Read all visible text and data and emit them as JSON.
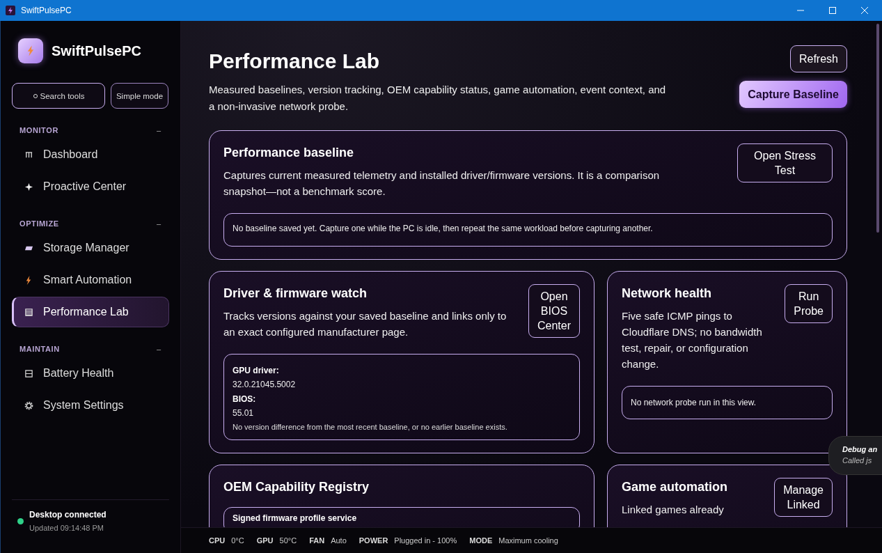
{
  "window": {
    "title": "SwiftPulsePC"
  },
  "sidebar": {
    "brand": "SwiftPulsePC",
    "search_button": "Search tools",
    "mode_button": "Simple mode",
    "sections": [
      {
        "label": "MONITOR",
        "collapse": "–",
        "items": [
          {
            "label": "Dashboard",
            "selected": false
          },
          {
            "label": "Proactive Center",
            "selected": false
          }
        ]
      },
      {
        "label": "OPTIMIZE",
        "collapse": "–",
        "items": [
          {
            "label": "Storage Manager",
            "selected": false
          },
          {
            "label": "Smart Automation",
            "selected": false
          },
          {
            "label": "Performance Lab",
            "selected": true
          }
        ]
      },
      {
        "label": "MAINTAIN",
        "collapse": "–",
        "items": [
          {
            "label": "Battery Health",
            "selected": false
          },
          {
            "label": "System Settings",
            "selected": false
          }
        ]
      }
    ],
    "connection": {
      "title": "Desktop connected",
      "updated": "Updated 09:14:48 PM",
      "connected": true
    }
  },
  "page": {
    "title": "Performance Lab",
    "subtitle": "Measured baselines, version tracking, OEM capability status, game automation, event context, and a non-invasive network probe.",
    "buttons": [
      {
        "label": "Refresh",
        "kind": "secondary"
      },
      {
        "label": "Capture Baseline",
        "kind": "primary"
      }
    ]
  },
  "cards": [
    {
      "kind": "note",
      "wide": true,
      "title": "Performance baseline",
      "description": "Captures current measured telemetry and installed driver/firmware versions. It is a comparison snapshot—not a benchmark score.",
      "button": "Open Stress Test",
      "note": "No baseline saved yet. Capture one while the PC is idle, then repeat the same workload before capturing another."
    },
    {
      "kind": "versions",
      "wide": false,
      "title": "Driver & firmware watch",
      "description": "Tracks versions against your saved baseline and links only to an exact configured manufacturer page.",
      "button": "Open BIOS Center",
      "versions": [
        {
          "label": "GPU driver:",
          "value": "32.0.21045.5002"
        },
        {
          "label": "BIOS:",
          "value": "55.01"
        }
      ],
      "footnote": "No version difference from the most recent baseline, or no earlier baseline exists."
    },
    {
      "kind": "note",
      "wide": false,
      "title": "Network health",
      "description": "Five safe ICMP pings to Cloudflare DNS; no bandwidth test, repair, or configuration change.",
      "button": "Run Probe",
      "note": "No network probe run in this view."
    },
    {
      "kind": "registry",
      "wide": false,
      "title": "OEM Capability Registry",
      "entry": "Signed firmware profile service"
    },
    {
      "kind": "plain",
      "wide": false,
      "title": "Game automation",
      "description": "Linked games already",
      "button": "Manage Linked"
    }
  ],
  "status_bar": [
    {
      "label": "CPU",
      "value": "0°C"
    },
    {
      "label": "GPU",
      "value": "50°C"
    },
    {
      "label": "FAN",
      "value": "Auto"
    },
    {
      "label": "POWER",
      "value": "Plugged in - 100%"
    },
    {
      "label": "MODE",
      "value": "Maximum cooling"
    }
  ],
  "toast": {
    "title": "Debug an",
    "text": "Called js"
  }
}
